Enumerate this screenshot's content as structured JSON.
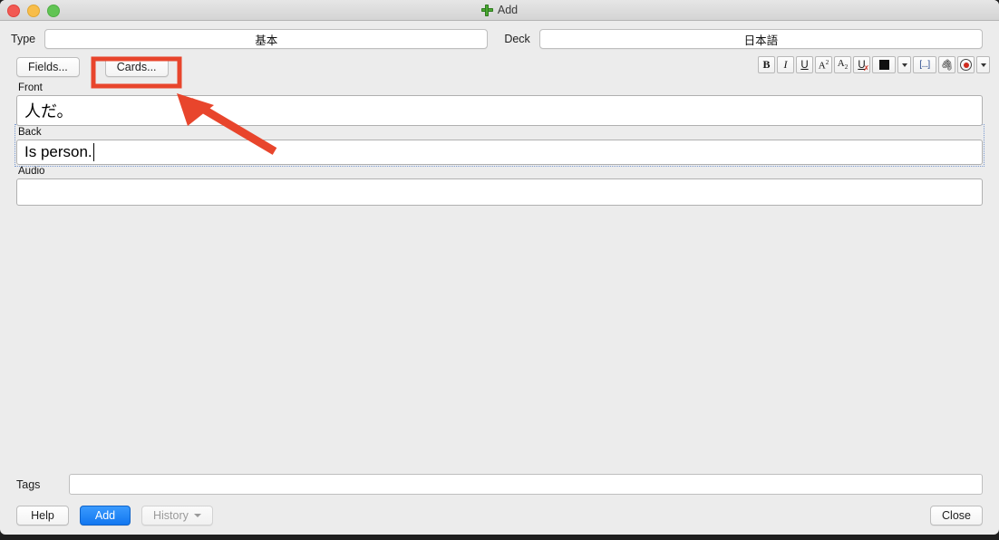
{
  "window": {
    "title": "Add",
    "title_icon": "green-plus-icon",
    "traffic_lights": [
      "close-red",
      "minimize-yellow",
      "zoom-green"
    ]
  },
  "top_row": {
    "type_label": "Type",
    "type_value": "基本",
    "deck_label": "Deck",
    "deck_value": "日本語"
  },
  "button_row": {
    "fields_label": "Fields...",
    "cards_label": "Cards..."
  },
  "format_toolbar": {
    "buttons": [
      {
        "name": "bold-button",
        "label": "B"
      },
      {
        "name": "italic-button",
        "label": "I"
      },
      {
        "name": "underline-button",
        "label": "U"
      },
      {
        "name": "superscript-button",
        "label": "A2"
      },
      {
        "name": "subscript-button",
        "label": "A2"
      },
      {
        "name": "clear-formatting-button",
        "label": "U"
      },
      {
        "name": "text-color-button",
        "label": ""
      },
      {
        "name": "text-color-dropdown",
        "label": ""
      },
      {
        "name": "cloze-button",
        "label": "[...]"
      },
      {
        "name": "attach-media-button",
        "label": ""
      },
      {
        "name": "record-audio-button",
        "label": ""
      },
      {
        "name": "more-options-dropdown",
        "label": ""
      }
    ]
  },
  "note_fields": [
    {
      "name": "Front",
      "value": "人だ。",
      "focused": false
    },
    {
      "name": "Back",
      "value": "Is person.",
      "focused": true
    },
    {
      "name": "Audio",
      "value": "",
      "focused": false
    }
  ],
  "bottom": {
    "tags_label": "Tags",
    "tags_value": "",
    "tags_placeholder": "",
    "help_label": "Help",
    "add_label": "Add",
    "history_label": "History",
    "close_label": "Close"
  },
  "annotation": {
    "type": "arrow-and-box",
    "color": "#e8452c",
    "target": "Cards..."
  }
}
